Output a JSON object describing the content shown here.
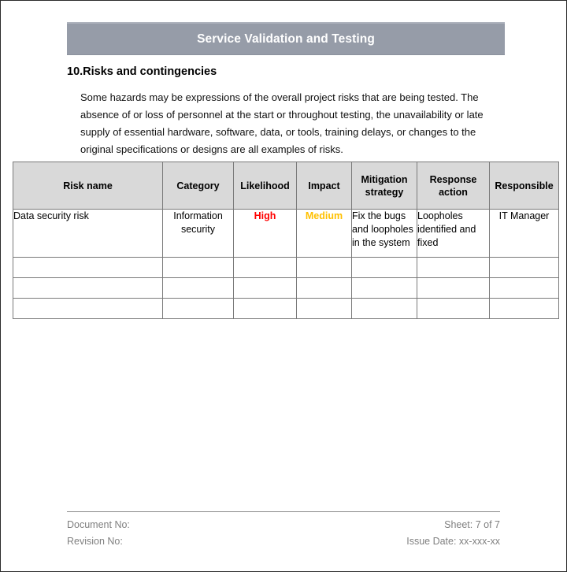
{
  "banner": {
    "title": "Service Validation and Testing",
    "bg_color": "#969CA8",
    "text_color": "#FFFFFF"
  },
  "section": {
    "heading": "10.Risks and contingencies",
    "paragraph": "Some hazards may be expressions of the overall project risks that are being tested. The absence of or loss of personnel at the start or throughout testing, the unavailability or late supply of essential hardware, software, data, or tools, training delays, or changes to the original specifications or designs are all examples of risks."
  },
  "risk_table": {
    "header_bg": "#D9D9D9",
    "columns": [
      "Risk name",
      "Category",
      "Likelihood",
      "Impact",
      "Mitigation strategy",
      "Response action",
      "Responsible"
    ],
    "rows": [
      {
        "risk_name": "Data security risk",
        "category": "Information security",
        "likelihood": "High",
        "likelihood_color": "#FF0000",
        "impact": "Medium",
        "impact_color": "#FFC000",
        "mitigation_strategy": "Fix the bugs and loopholes in the system",
        "response_action": "Loopholes identified and fixed",
        "responsible": "IT Manager"
      },
      {
        "risk_name": "",
        "category": "",
        "likelihood": "",
        "impact": "",
        "mitigation_strategy": "",
        "response_action": "",
        "responsible": ""
      },
      {
        "risk_name": "",
        "category": "",
        "likelihood": "",
        "impact": "",
        "mitigation_strategy": "",
        "response_action": "",
        "responsible": ""
      },
      {
        "risk_name": "",
        "category": "",
        "likelihood": "",
        "impact": "",
        "mitigation_strategy": "",
        "response_action": "",
        "responsible": ""
      }
    ]
  },
  "footer": {
    "document_no": "Document No:",
    "revision_no": "Revision No:",
    "sheet": "Sheet: 7 of 7",
    "issue_date": "Issue Date: xx-xxx-xx",
    "text_color": "#808080"
  }
}
